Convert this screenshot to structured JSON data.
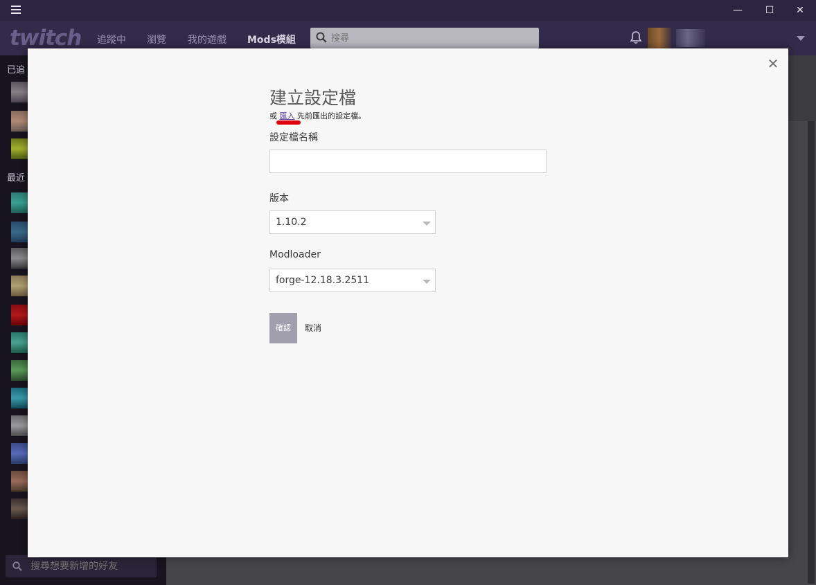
{
  "window": {
    "minimize_glyph": "—",
    "maximize_glyph": "☐",
    "close_glyph": "✕"
  },
  "nav": {
    "logo": "twitch",
    "links": [
      "追蹤中",
      "瀏覽",
      "我的遊戲",
      "Mods模組"
    ],
    "active_link": "Mods模組",
    "search_placeholder": "搜尋"
  },
  "sidebar": {
    "section_following": "已追",
    "section_recent": "最近",
    "friend_search_placeholder": "搜尋想要新增的好友"
  },
  "modal": {
    "close_glyph": "✕",
    "title": "建立設定檔",
    "subtitle_prefix": "或",
    "subtitle_link": "匯入",
    "subtitle_suffix": "先前匯出的設定檔。",
    "profile_name_label": "設定檔名稱",
    "profile_name_value": "",
    "version_label": "版本",
    "version_value": "1.10.2",
    "modloader_label": "Modloader",
    "modloader_value": "forge-12.18.3.2511",
    "confirm_label": "確認",
    "cancel_label": "取消"
  },
  "colors": {
    "titlebar": "#2c2541",
    "navbar": "#322b4a",
    "modal_bg": "#f7f7f7",
    "link": "#5b3fa6",
    "confirm_button": "#a19eae",
    "annotation_red": "#e0000a"
  },
  "icons": [
    "menu-icon",
    "search-icon",
    "bell-icon",
    "close-icon",
    "chevron-down-icon"
  ]
}
